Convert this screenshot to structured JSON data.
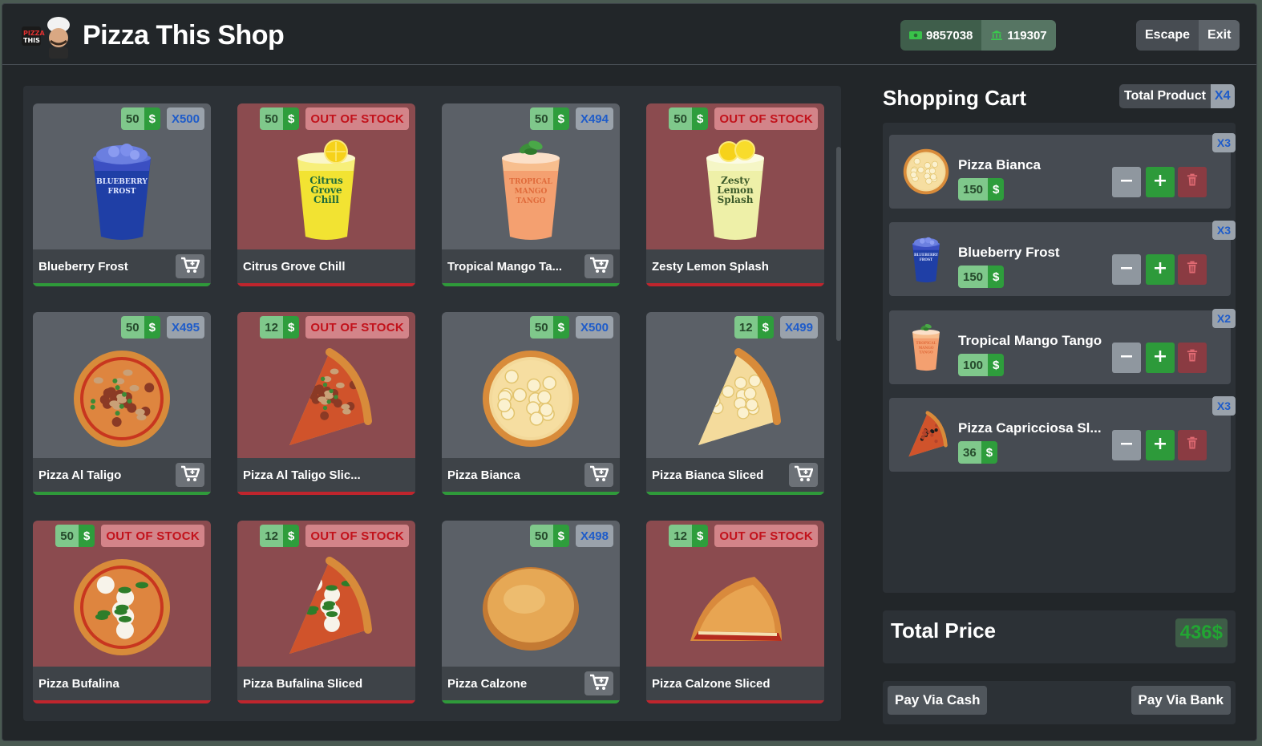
{
  "header": {
    "title": "Pizza This Shop",
    "cash": "9857038",
    "bank": "119307",
    "escape_label": "Escape",
    "exit_label": "Exit"
  },
  "products": [
    {
      "name": "Blueberry Frost",
      "price": "50",
      "currency": "$",
      "stock": "X500",
      "out_of_stock": false,
      "image": "blueberry-frost-cup"
    },
    {
      "name": "Citrus Grove Chill",
      "price": "50",
      "currency": "$",
      "stock": "OUT OF STOCK",
      "out_of_stock": true,
      "image": "citrus-grove-chill-cup"
    },
    {
      "name": "Tropical Mango Ta...",
      "price": "50",
      "currency": "$",
      "stock": "X494",
      "out_of_stock": false,
      "image": "tropical-mango-tango-cup"
    },
    {
      "name": "Zesty Lemon Splash",
      "price": "50",
      "currency": "$",
      "stock": "OUT OF STOCK",
      "out_of_stock": true,
      "image": "zesty-lemon-splash-cup"
    },
    {
      "name": "Pizza Al Taligo",
      "price": "50",
      "currency": "$",
      "stock": "X495",
      "out_of_stock": false,
      "image": "pizza-al-taligo"
    },
    {
      "name": "Pizza Al Taligo Slic...",
      "price": "12",
      "currency": "$",
      "stock": "OUT OF STOCK",
      "out_of_stock": true,
      "image": "pizza-al-taligo-slice"
    },
    {
      "name": "Pizza Bianca",
      "price": "50",
      "currency": "$",
      "stock": "X500",
      "out_of_stock": false,
      "image": "pizza-bianca"
    },
    {
      "name": "Pizza Bianca Sliced",
      "price": "12",
      "currency": "$",
      "stock": "X499",
      "out_of_stock": false,
      "image": "pizza-bianca-slice"
    },
    {
      "name": "Pizza Bufalina",
      "price": "50",
      "currency": "$",
      "stock": "OUT OF STOCK",
      "out_of_stock": true,
      "image": "pizza-bufalina"
    },
    {
      "name": "Pizza Bufalina Sliced",
      "price": "12",
      "currency": "$",
      "stock": "OUT OF STOCK",
      "out_of_stock": true,
      "image": "pizza-bufalina-slice"
    },
    {
      "name": "Pizza Calzone",
      "price": "50",
      "currency": "$",
      "stock": "X498",
      "out_of_stock": false,
      "image": "pizza-calzone"
    },
    {
      "name": "Pizza Calzone Sliced",
      "price": "12",
      "currency": "$",
      "stock": "OUT OF STOCK",
      "out_of_stock": true,
      "image": "pizza-calzone-slice"
    }
  ],
  "cart": {
    "title": "Shopping Cart",
    "total_product_label": "Total Product",
    "total_product_count": "X4",
    "items": [
      {
        "name": "Pizza Bianca",
        "price": "150",
        "currency": "$",
        "qty": "X3",
        "image": "pizza-bianca"
      },
      {
        "name": "Blueberry Frost",
        "price": "150",
        "currency": "$",
        "qty": "X3",
        "image": "blueberry-frost-cup"
      },
      {
        "name": "Tropical Mango Tango",
        "price": "100",
        "currency": "$",
        "qty": "X2",
        "image": "tropical-mango-tango-cup"
      },
      {
        "name": "Pizza Capricciosa Sl...",
        "price": "36",
        "currency": "$",
        "qty": "X3",
        "image": "pizza-capricciosa-slice"
      }
    ],
    "total_label": "Total Price",
    "total_value": "436$",
    "pay_cash_label": "Pay Via Cash",
    "pay_bank_label": "Pay Via Bank"
  }
}
